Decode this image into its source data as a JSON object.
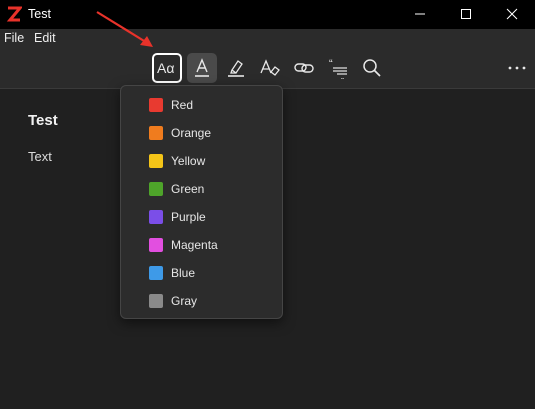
{
  "window": {
    "title": "Test"
  },
  "menubar": {
    "file_label": "File",
    "edit_label": "Edit"
  },
  "editor": {
    "heading": "Test",
    "body_text": "Text"
  },
  "color_menu": {
    "items": [
      {
        "label": "Red",
        "color": "#e83a30"
      },
      {
        "label": "Orange",
        "color": "#f07c1e"
      },
      {
        "label": "Yellow",
        "color": "#f5c518"
      },
      {
        "label": "Green",
        "color": "#4ea42a"
      },
      {
        "label": "Purple",
        "color": "#7b4ee8"
      },
      {
        "label": "Magenta",
        "color": "#e24fe0"
      },
      {
        "label": "Blue",
        "color": "#3e9ae8"
      },
      {
        "label": "Gray",
        "color": "#8a8a8a"
      }
    ]
  },
  "toolbar": {
    "icons": [
      "text-style-icon",
      "text-color-icon",
      "highlight-icon",
      "clear-formatting-icon",
      "link-icon",
      "citation-icon",
      "search-icon",
      "more-icon"
    ]
  },
  "colors": {
    "accent_arrow": "#e8322a",
    "app_logo": "#e8322a"
  }
}
